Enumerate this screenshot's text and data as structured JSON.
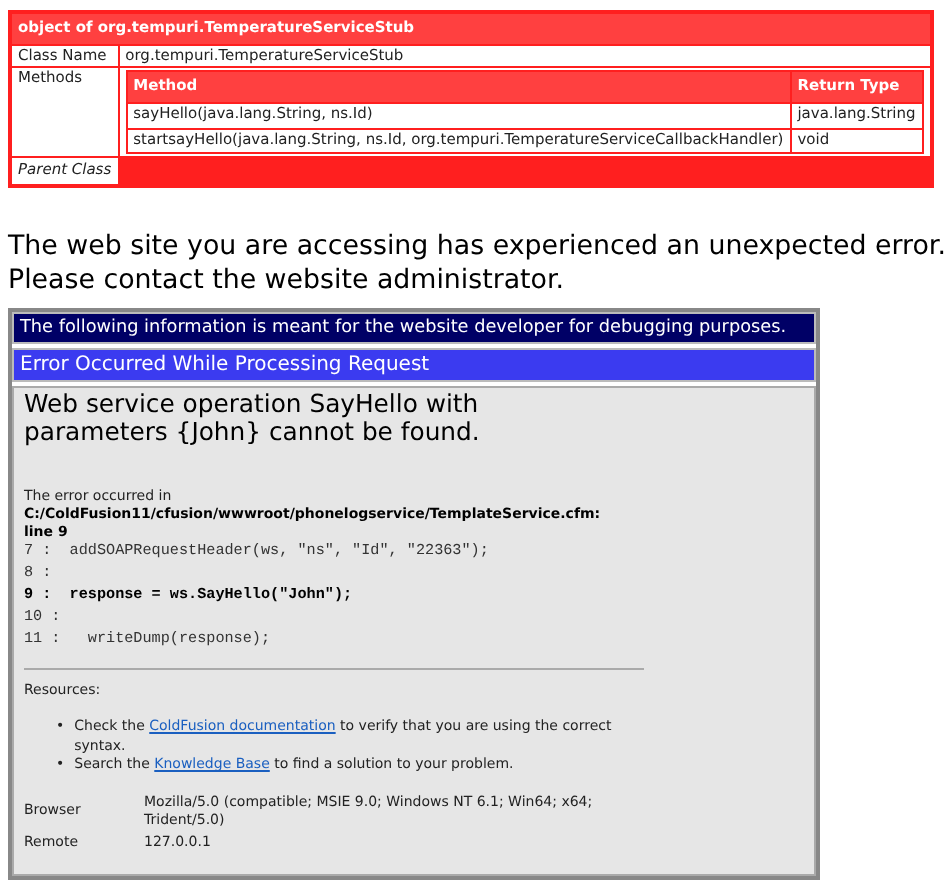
{
  "dump": {
    "title": "object of org.tempuri.TemperatureServiceStub",
    "class_name": {
      "label": "Class Name",
      "value": "org.tempuri.TemperatureServiceStub"
    },
    "methods": {
      "label": "Methods",
      "columns": [
        "Method",
        "Return Type"
      ],
      "rows": [
        [
          "sayHello(java.lang.String, ns.Id)",
          "java.lang.String"
        ],
        [
          "startsayHello(java.lang.String, ns.Id, org.tempuri.TemperatureServiceCallbackHandler)",
          "void"
        ]
      ]
    },
    "parent_class": {
      "label": "Parent Class"
    }
  },
  "error_message": "The web site you are accessing has experienced an unexpected error. Please contact the website administrator.",
  "debug": {
    "notice": "The following information is meant for the website developer for debugging purposes.",
    "heading": "Error Occurred While Processing Request",
    "message": "Web service operation SayHello with parameters {John} cannot be found.",
    "location_intro": "The error occurred in",
    "location_path": "C:/ColdFusion11/cfusion/wwwroot/phonelogservice/TemplateService.cfm: line 9",
    "code_lines": [
      {
        "number": "7 :",
        "code": "addSOAPRequestHeader(ws, \"ns\", \"Id\", \"22363\");",
        "highlighted": false
      },
      {
        "number": "8 :",
        "highlighted": false
      },
      {
        "number": "9 :",
        "code": "response = ws.SayHello(\"John\");",
        "highlighted": true
      },
      {
        "number": "10 :",
        "highlighted": false
      },
      {
        "number": "11 :",
        "code": " writeDump(response);",
        "highlighted": false
      }
    ],
    "resources_label": "Resources:",
    "resources": [
      {
        "bullet": "•",
        "before": "Check the",
        "link": "ColdFusion documentation",
        "after": "to verify that you are using the correct syntax."
      },
      {
        "bullet": "•",
        "before": "Search the",
        "link": "Knowledge Base",
        "after": "to find a solution to your problem."
      }
    ],
    "info": [
      {
        "label": "Browser",
        "value": "Mozilla/5.0 (compatible; MSIE 9.0; Windows NT 6.1; Win64; x64; Trident/5.0)"
      },
      {
        "label": "Remote",
        "value": "127.0.0.1"
      }
    ]
  }
}
